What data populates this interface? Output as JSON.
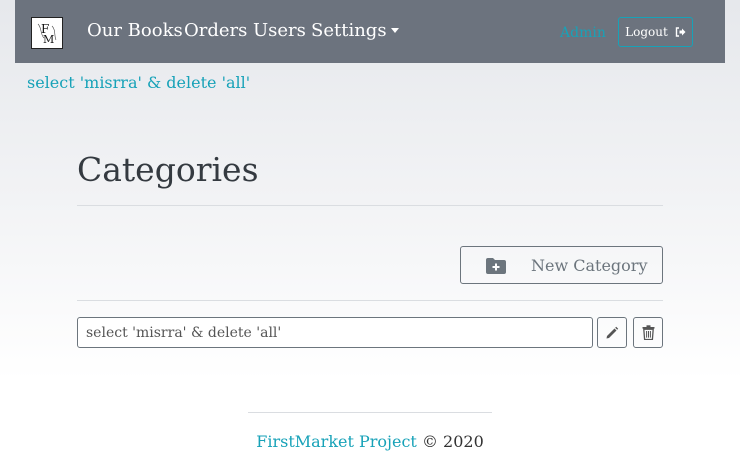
{
  "navbar": {
    "brand_alt": "FM",
    "items": [
      {
        "label": "Our Books"
      },
      {
        "label": "Orders"
      },
      {
        "label": "Users"
      },
      {
        "label": "Settings"
      }
    ],
    "admin_label": "Admin",
    "logout_label": "Logout",
    "logout_icon": "sign-out-icon",
    "bg_color": "#6c737e"
  },
  "flash": {
    "text": "select 'misrra' & delete 'all'"
  },
  "main": {
    "title": "Categories",
    "new_category_label": "New Category",
    "new_category_icon": "folder-plus-icon",
    "categories": [
      {
        "value": "select 'misrra' & delete 'all'"
      }
    ],
    "edit_icon": "pencil-icon",
    "delete_icon": "trash-icon"
  },
  "footer": {
    "link_text": "FirstMarket Project",
    "copyright": "© 2020"
  },
  "colors": {
    "accent": "#17a2b8",
    "secondary": "#6c757d"
  }
}
